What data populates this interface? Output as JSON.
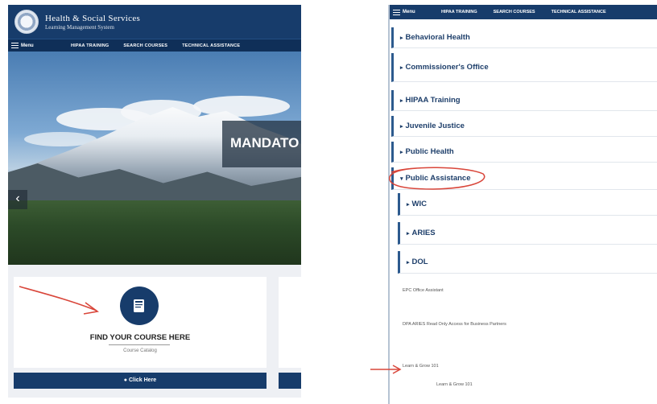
{
  "left_panel": {
    "header": {
      "title_line1": "Health & Social Services",
      "title_line2": "Learning Management System"
    },
    "nav": {
      "menu": "Menu",
      "items": [
        "HIPAA TRAINING",
        "SEARCH COURSES",
        "TECHNICAL ASSISTANCE"
      ]
    },
    "hero": {
      "caption": "MANDATO",
      "prev_arrow": "‹"
    },
    "card": {
      "title": "FIND YOUR COURSE HERE",
      "subtitle": "Course Catalog",
      "button": "● Click Here"
    }
  },
  "right_panel": {
    "nav": {
      "menu": "Menu",
      "items": [
        "HIPAA TRAINING",
        "SEARCH COURSES",
        "TECHNICAL ASSISTANCE"
      ]
    },
    "accordion": [
      {
        "label": "Behavioral Health"
      },
      {
        "label": "Commissioner's Office"
      },
      {
        "label": "HIPAA Training"
      },
      {
        "label": "Juvenile Justice"
      },
      {
        "label": "Public Health"
      },
      {
        "label": "Public Assistance"
      }
    ],
    "sub_accordion": [
      {
        "label": "WIC"
      },
      {
        "label": "ARIES"
      },
      {
        "label": "DOL"
      }
    ],
    "courses": [
      "EPC Office Assistant",
      "DPA ARIES Read Only Access for Business Partners",
      "Learn & Grow 101"
    ],
    "sub_course": "Learn & Grow 101"
  },
  "colors": {
    "brand_navy": "#173c6b",
    "annotation_red": "#d9463a"
  }
}
